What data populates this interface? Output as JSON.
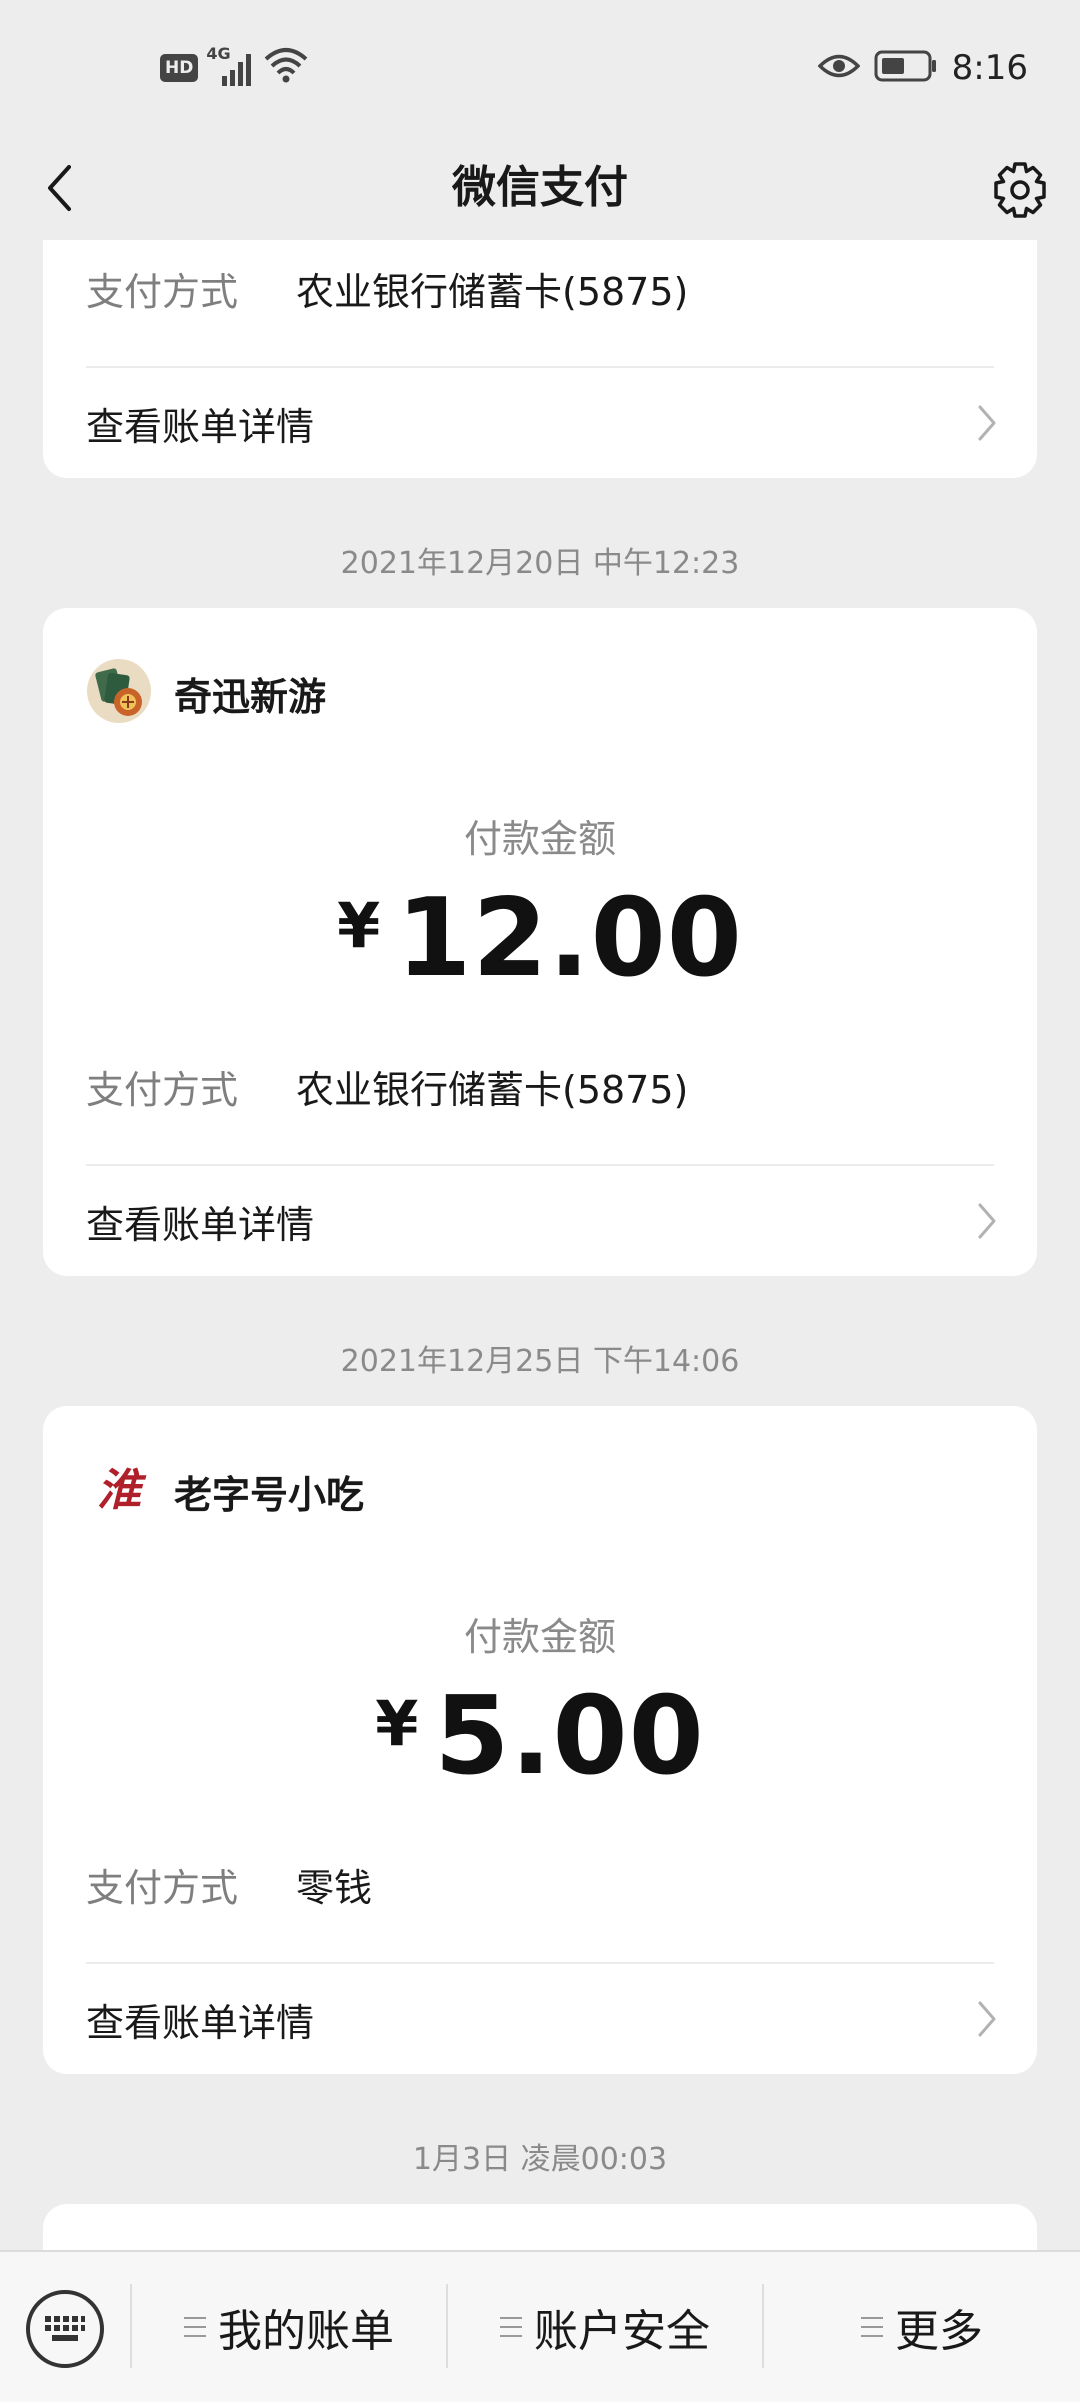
{
  "status_bar": {
    "hd": "HD",
    "network": "4G",
    "time": "8:16"
  },
  "header": {
    "title": "微信支付"
  },
  "records": [
    {
      "payment_label": "支付方式",
      "payment_method": "农业银行储蓄卡(5875)",
      "detail_label": "查看账单详情"
    },
    {
      "date": "2021年12月20日 中午12:23",
      "merchant": "奇迅新游",
      "amount_label": "付款金额",
      "currency": "¥",
      "amount": "12.00",
      "payment_label": "支付方式",
      "payment_method": "农业银行储蓄卡(5875)",
      "detail_label": "查看账单详情"
    },
    {
      "date": "2021年12月25日 下午14:06",
      "merchant": "老字号小吃",
      "merchant_logo_text": "淮",
      "amount_label": "付款金额",
      "currency": "¥",
      "amount": "5.00",
      "payment_label": "支付方式",
      "payment_method": "零钱",
      "detail_label": "查看账单详情"
    },
    {
      "date": "1月3日 凌晨00:03"
    }
  ],
  "bottom_menu": {
    "keyboard_icon": "keyboard-icon",
    "items": [
      {
        "label": "我的账单"
      },
      {
        "label": "账户安全"
      },
      {
        "label": "更多"
      }
    ]
  },
  "colors": {
    "background": "#ededed",
    "card": "#ffffff",
    "secondary_text": "#7f7f7f",
    "logo_red": "#b0202a"
  }
}
